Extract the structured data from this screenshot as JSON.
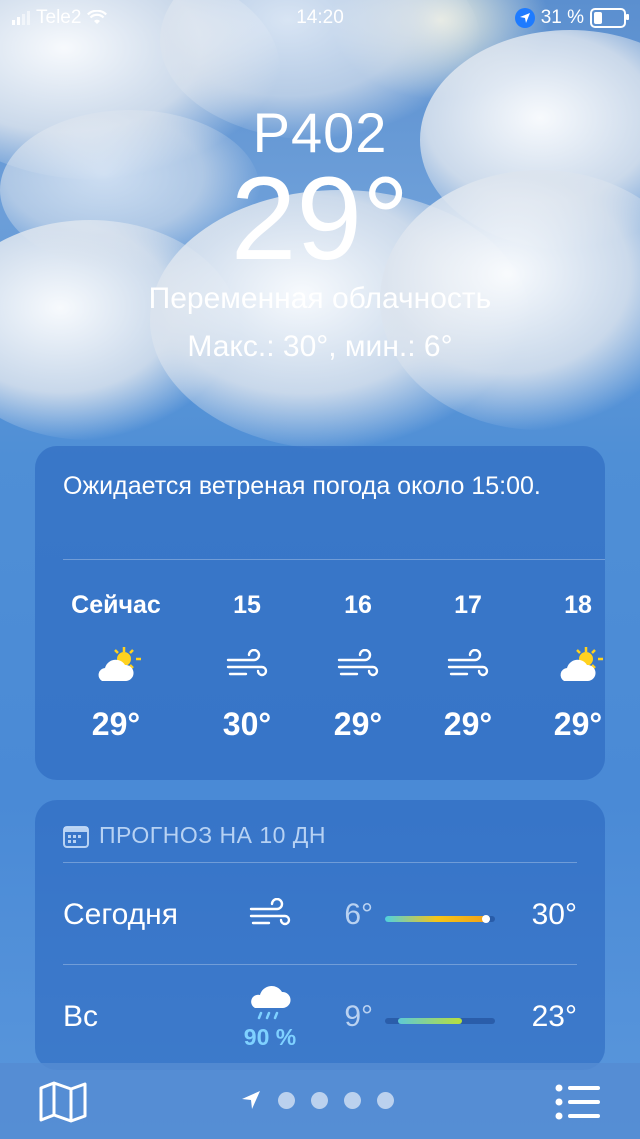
{
  "status_bar": {
    "carrier": "Tele2",
    "time": "14:20",
    "battery": "31 %",
    "battery_level": 0.31
  },
  "hero": {
    "location": "Р402",
    "temperature": "29°",
    "condition": "Переменная облачность",
    "hi_lo": "Макс.: 30°, мин.: 6°"
  },
  "hourly": {
    "alert": "Ожидается ветреная погода около 15:00.",
    "items": [
      {
        "label": "Сейчас",
        "icon": "partly-cloudy-icon",
        "temp": "29°"
      },
      {
        "label": "15",
        "icon": "wind-icon",
        "temp": "30°"
      },
      {
        "label": "16",
        "icon": "wind-icon",
        "temp": "29°"
      },
      {
        "label": "17",
        "icon": "wind-icon",
        "temp": "29°"
      },
      {
        "label": "18",
        "icon": "partly-cloudy-icon",
        "temp": "29°"
      }
    ]
  },
  "forecast": {
    "header": "ПРОГНОЗ НА 10 ДН",
    "header_icon": "calendar-icon",
    "days": [
      {
        "day": "Сегодня",
        "icon": "wind-icon",
        "pop": "",
        "low": "6°",
        "high": "30°",
        "range_start": 0.0,
        "range_end": 0.95,
        "current": 0.92,
        "gradient": [
          "#4fd1e0",
          "#f5c518",
          "#f0a01a"
        ]
      },
      {
        "day": "Вс",
        "icon": "rain-cloud-icon",
        "pop": "90 %",
        "low": "9°",
        "high": "23°",
        "range_start": 0.12,
        "range_end": 0.7,
        "gradient": [
          "#5ec9d6",
          "#b8df3c"
        ]
      }
    ]
  },
  "bottom_bar": {
    "map_icon": "map-icon",
    "list_icon": "list-icon",
    "pager_dots": 4
  }
}
